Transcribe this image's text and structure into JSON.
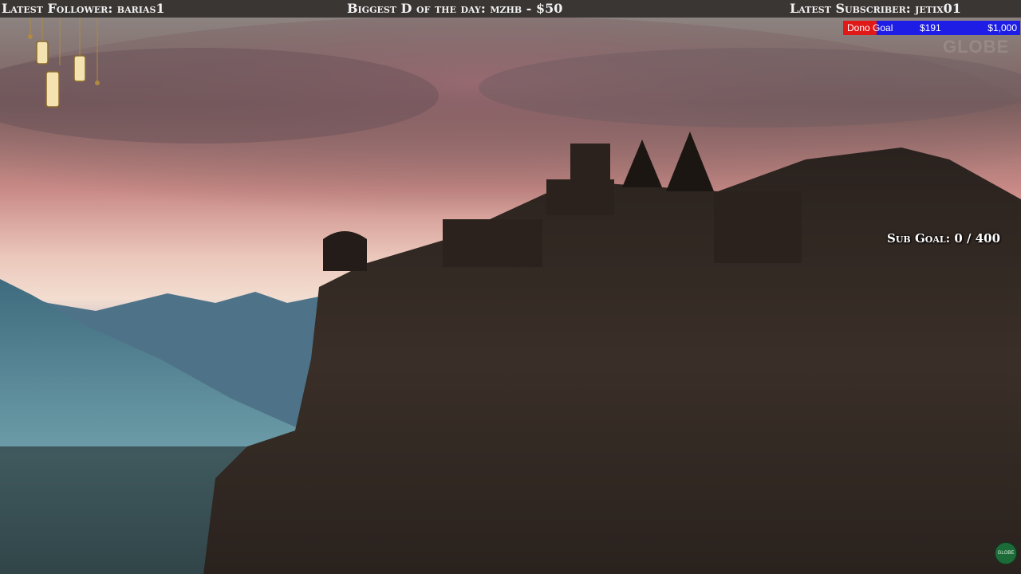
{
  "overlay": {
    "latest_follower": "Latest Follower: barias1",
    "biggest_donation": "Biggest D of the day: mzhb - $50",
    "latest_subscriber": "Latest Subscriber: jetix01",
    "dono_goal": {
      "label": "Dono Goal",
      "current": "$191",
      "max": "$1,000",
      "progress": 0.191
    },
    "sub_goal": "Sub Goal: 0 / 400",
    "watermark": "GLOBE",
    "corner_logo": "GLOBE"
  },
  "colors": {
    "topbar": "#3a3634",
    "dono_fill": "#e01818",
    "dono_track": "#1d1de6"
  },
  "icons": [
    "lantern-icon"
  ]
}
